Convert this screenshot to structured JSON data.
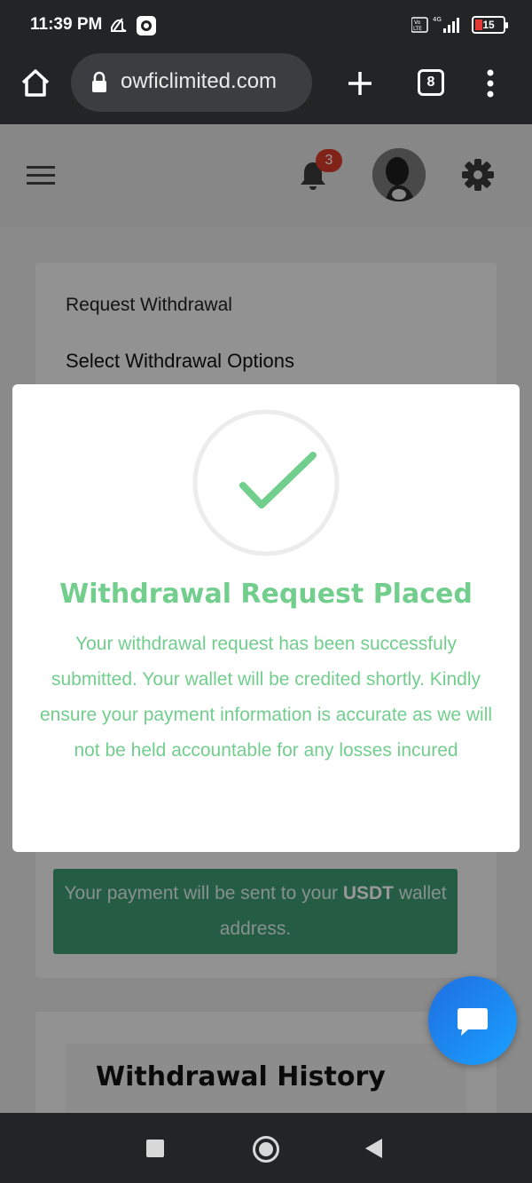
{
  "status_bar": {
    "time": "11:39 PM",
    "battery_level": "15"
  },
  "browser": {
    "url": "owficlimited.com",
    "tab_count": "8"
  },
  "header": {
    "notification_count": "3"
  },
  "card": {
    "title": "Request Withdrawal",
    "subtitle": "Select Withdrawal Options",
    "notice_prefix": "Your payment will be sent to your ",
    "notice_currency": "USDT",
    "notice_suffix": " wallet address."
  },
  "history": {
    "title": "Withdrawal History"
  },
  "modal": {
    "title": "Withdrawal Request Placed",
    "body": "Your withdrawal request has been successfuly submitted. Your wallet will be credited shortly. Kindly ensure your payment information is accurate as we will not be held accountable for any losses incured",
    "accent_color": "#72ce8d"
  },
  "colors": {
    "notice_bg": "#3d9a72",
    "badge": "#d93b2b",
    "chat_fab": "#1f6fe0"
  }
}
